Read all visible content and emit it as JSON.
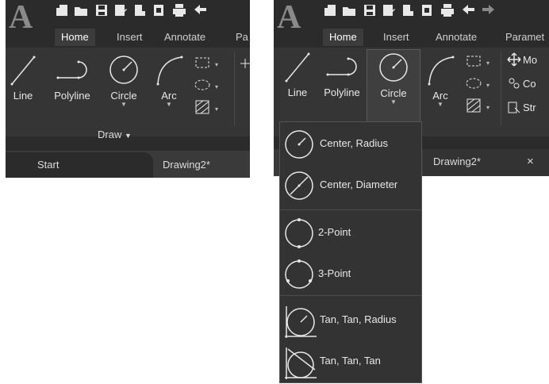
{
  "left": {
    "tabs": [
      "Home",
      "Insert",
      "Annotate",
      "Pa"
    ],
    "tools": [
      "Line",
      "Polyline",
      "Circle",
      "Arc"
    ],
    "panel_title": "Draw",
    "doc_tabs": [
      "Start",
      "Drawing2*"
    ]
  },
  "right": {
    "tabs": [
      "Home",
      "Insert",
      "Annotate",
      "Paramet"
    ],
    "tools": [
      "Line",
      "Polyline",
      "Circle",
      "Arc"
    ],
    "modify": [
      "Mo",
      "Co",
      "Str"
    ],
    "doc_tab": "Drawing2*",
    "close": "×"
  },
  "dropdown": {
    "items": [
      "Center, Radius",
      "Center, Diameter",
      "2-Point",
      "3-Point",
      "Tan, Tan, Radius",
      "Tan, Tan, Tan"
    ]
  },
  "icons": [
    "autocad-logo",
    "new-icon",
    "open-icon",
    "save-icon",
    "save-as-icon",
    "plot-icon",
    "print-icon",
    "undo-icon"
  ],
  "colors": {
    "bg": "#2b2b2b",
    "ribbon": "#353535",
    "text": "#e8e8e8",
    "dropdown": "#333333"
  }
}
